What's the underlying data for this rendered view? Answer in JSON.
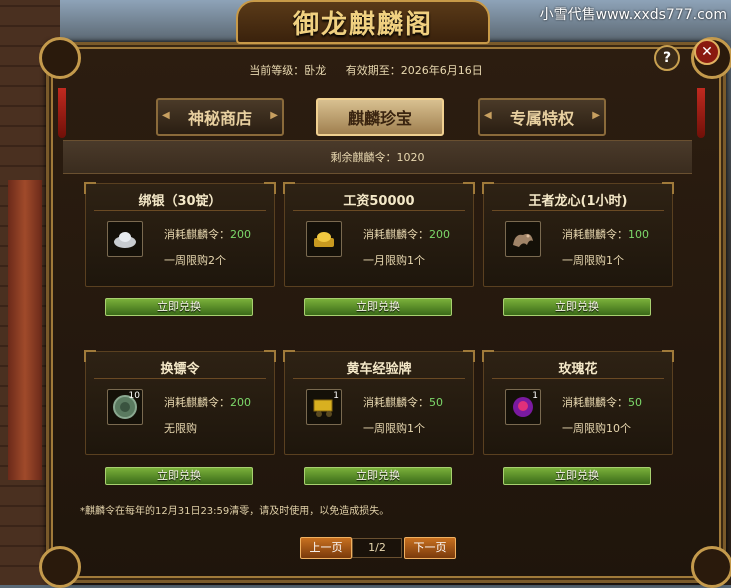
{
  "watermark": "小雪代售www.xxds777.com",
  "title": "御龙麒麟阁",
  "info": {
    "level_label": "当前等级：卧龙",
    "expire_label": "有效期至：2026年6月16日"
  },
  "tabs": [
    {
      "label": "神秘商店",
      "active": false
    },
    {
      "label": "麒麟珍宝",
      "active": true
    },
    {
      "label": "专属特权",
      "active": false
    }
  ],
  "balance": "剩余麒麟令：1020",
  "cost_label": "消耗麒麟令：",
  "redeem_label": "立即兑换",
  "items": [
    {
      "name": "绑银（30锭）",
      "cost": "200",
      "limit": "一周限购2个",
      "icon": "silver-ingot-icon",
      "count": ""
    },
    {
      "name": "工资50000",
      "cost": "200",
      "limit": "一月限购1个",
      "icon": "gold-ingot-icon",
      "count": ""
    },
    {
      "name": "王者龙心(1小时)",
      "cost": "100",
      "limit": "一周限购1个",
      "icon": "dragon-heart-icon",
      "count": ""
    },
    {
      "name": "换镖令",
      "cost": "200",
      "limit": "无限购",
      "icon": "escort-token-icon",
      "count": "10"
    },
    {
      "name": "黄车经验牌",
      "cost": "50",
      "limit": "一周限购1个",
      "icon": "cart-exp-icon",
      "count": "1"
    },
    {
      "name": "玫瑰花",
      "cost": "50",
      "limit": "一周限购10个",
      "icon": "rose-icon",
      "count": "1"
    }
  ],
  "note": "*麒麟令在每年的12月31日23:59清零，请及时使用，以免造成损失。",
  "pagination": {
    "prev": "上一页",
    "page": "1/2",
    "next": "下一页"
  }
}
